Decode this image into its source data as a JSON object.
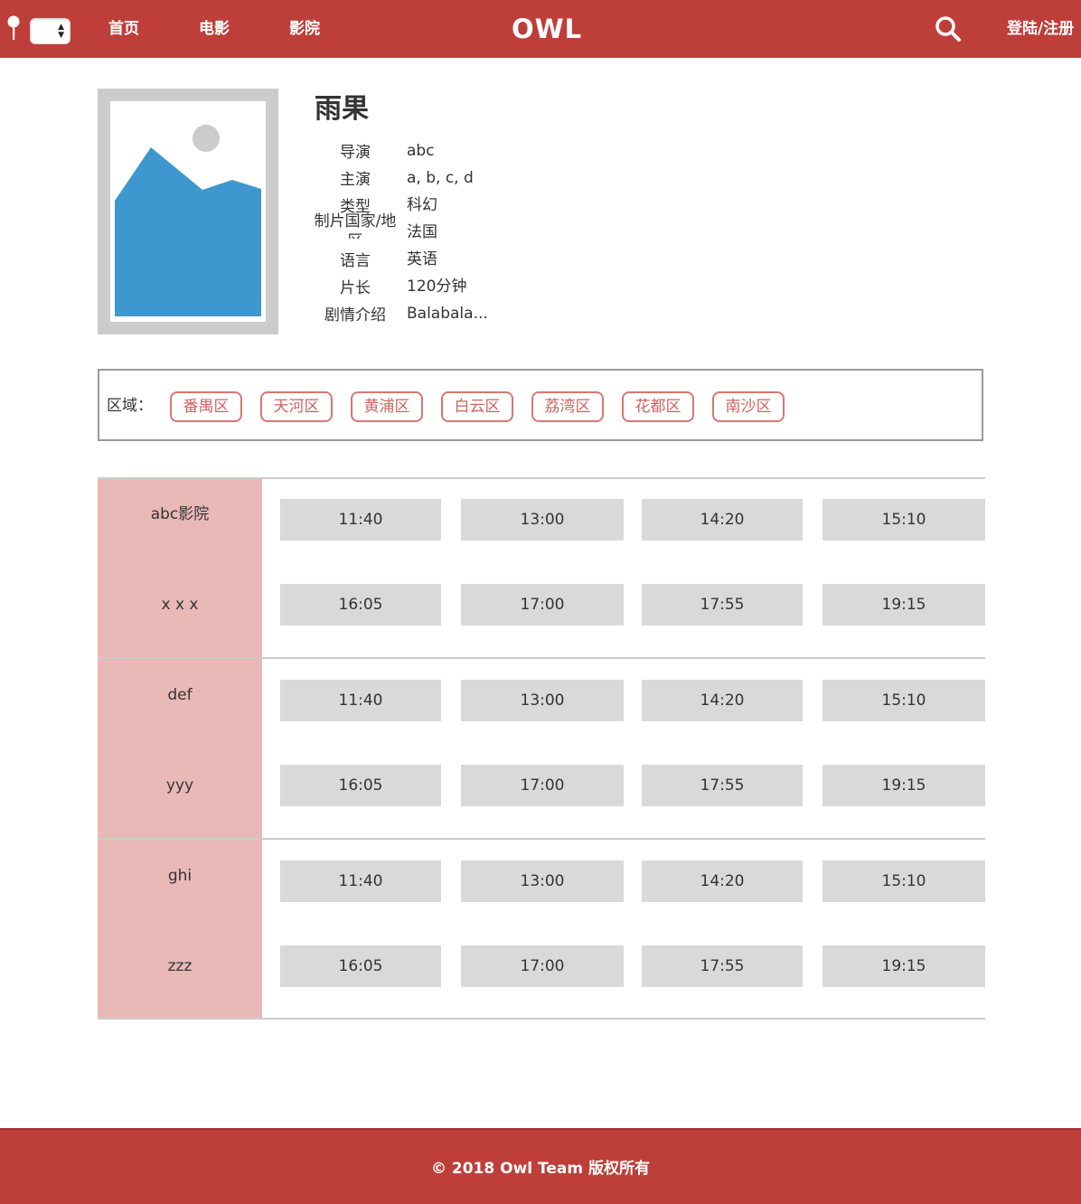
{
  "colors": {
    "brand_red": "#be3f3a",
    "cinema_side_pink": "#e8b9b7",
    "area_button_border": "#d97671",
    "time_button_bg": "#d9d9d9"
  },
  "header": {
    "nav": [
      "首页",
      "电影",
      "影院"
    ],
    "logo": "OWL",
    "login": "登陆/注册",
    "icons": {
      "location": "pin-icon",
      "search": "search-icon",
      "select": "city-select-arrows"
    }
  },
  "movie": {
    "title": "雨果",
    "poster_icon": "image-placeholder-icon",
    "info": [
      {
        "label": "导演",
        "value": "abc"
      },
      {
        "label": "主演",
        "value": "a, b, c, d"
      },
      {
        "label": "类型",
        "value": "科幻"
      },
      {
        "label": "制片国家/地区",
        "value": "法国"
      },
      {
        "label": "语言",
        "value": "英语"
      },
      {
        "label": "片长",
        "value": "120分钟"
      },
      {
        "label": "剧情介绍",
        "value": "Balabala..."
      }
    ]
  },
  "area_filter": {
    "label": "区域：",
    "areas": [
      "番禺区",
      "天河区",
      "黄浦区",
      "白云区",
      "荔湾区",
      "花都区",
      "南沙区"
    ]
  },
  "schedule": [
    {
      "names": [
        "abc影院",
        "x x x"
      ],
      "times": [
        [
          "11:40",
          "13:00",
          "14:20",
          "15:10"
        ],
        [
          "16:05",
          "17:00",
          "17:55",
          "19:15"
        ]
      ]
    },
    {
      "names": [
        "def",
        "yyy"
      ],
      "times": [
        [
          "11:40",
          "13:00",
          "14:20",
          "15:10"
        ],
        [
          "16:05",
          "17:00",
          "17:55",
          "19:15"
        ]
      ]
    },
    {
      "names": [
        "ghi",
        "zzz"
      ],
      "times": [
        [
          "11:40",
          "13:00",
          "14:20",
          "15:10"
        ],
        [
          "16:05",
          "17:00",
          "17:55",
          "19:15"
        ]
      ]
    }
  ],
  "footer": {
    "copyright": "© 2018 Owl Team 版权所有"
  }
}
